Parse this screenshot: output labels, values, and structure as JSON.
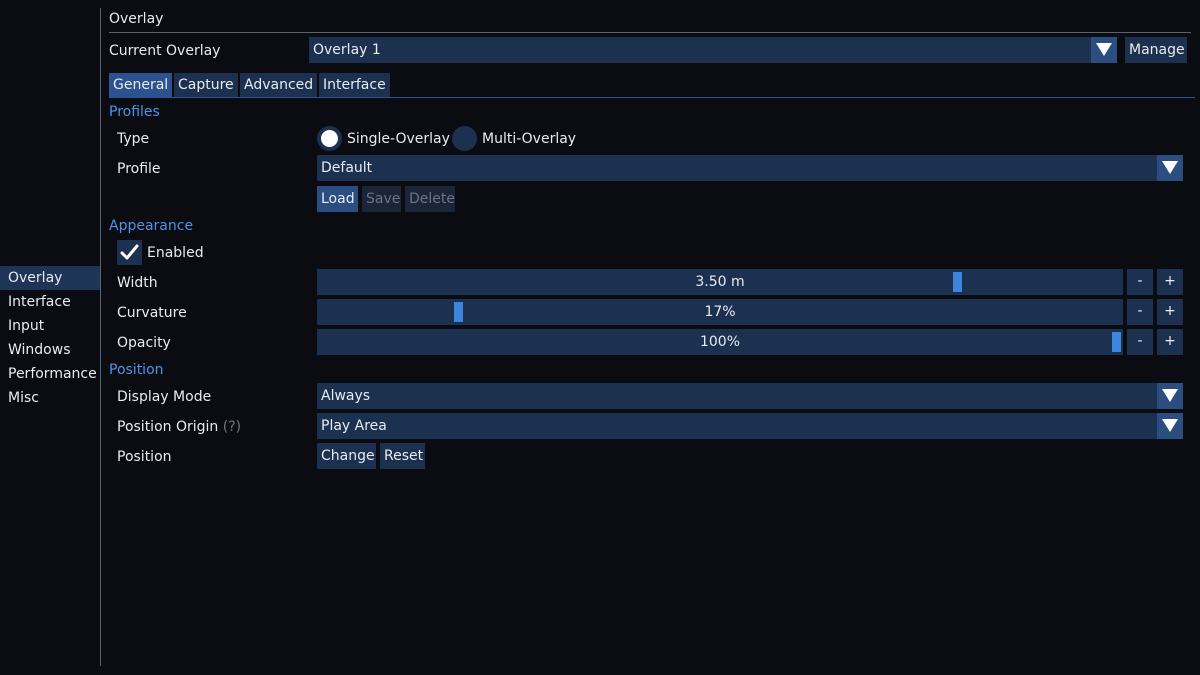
{
  "nav": {
    "items": [
      {
        "label": "Overlay",
        "active": true
      },
      {
        "label": "Interface"
      },
      {
        "label": "Input"
      },
      {
        "label": "Windows"
      },
      {
        "label": "Performance"
      },
      {
        "label": "Misc"
      }
    ]
  },
  "header": {
    "title": "Overlay",
    "current_label": "Current Overlay",
    "current_value": "Overlay 1",
    "manage_label": "Manage"
  },
  "tabs": [
    {
      "label": "General",
      "active": true
    },
    {
      "label": "Capture"
    },
    {
      "label": "Advanced"
    },
    {
      "label": "Interface"
    }
  ],
  "profiles": {
    "section": "Profiles",
    "type_label": "Type",
    "type_options": [
      {
        "label": "Single-Overlay",
        "selected": true
      },
      {
        "label": "Multi-Overlay",
        "selected": false
      }
    ],
    "profile_label": "Profile",
    "profile_value": "Default",
    "load_label": "Load",
    "save_label": "Save",
    "delete_label": "Delete"
  },
  "appearance": {
    "section": "Appearance",
    "enabled_label": "Enabled",
    "enabled": true,
    "width": {
      "label": "Width",
      "value": "3.50 m",
      "fraction": 0.8
    },
    "curvature": {
      "label": "Curvature",
      "value": "17%",
      "fraction": 0.17
    },
    "opacity": {
      "label": "Opacity",
      "value": "100%",
      "fraction": 1.0
    },
    "minus_label": "-",
    "plus_label": "+"
  },
  "position": {
    "section": "Position",
    "display_mode_label": "Display Mode",
    "display_mode_value": "Always",
    "origin_label": "Position Origin",
    "origin_help": "(?)",
    "origin_value": "Play Area",
    "position_label": "Position",
    "change_label": "Change",
    "reset_label": "Reset"
  },
  "colors": {
    "accent": "#3d85dd",
    "section_text": "#4f93e6",
    "widget_bg": "#1c3050",
    "background": "#0b0c11"
  }
}
